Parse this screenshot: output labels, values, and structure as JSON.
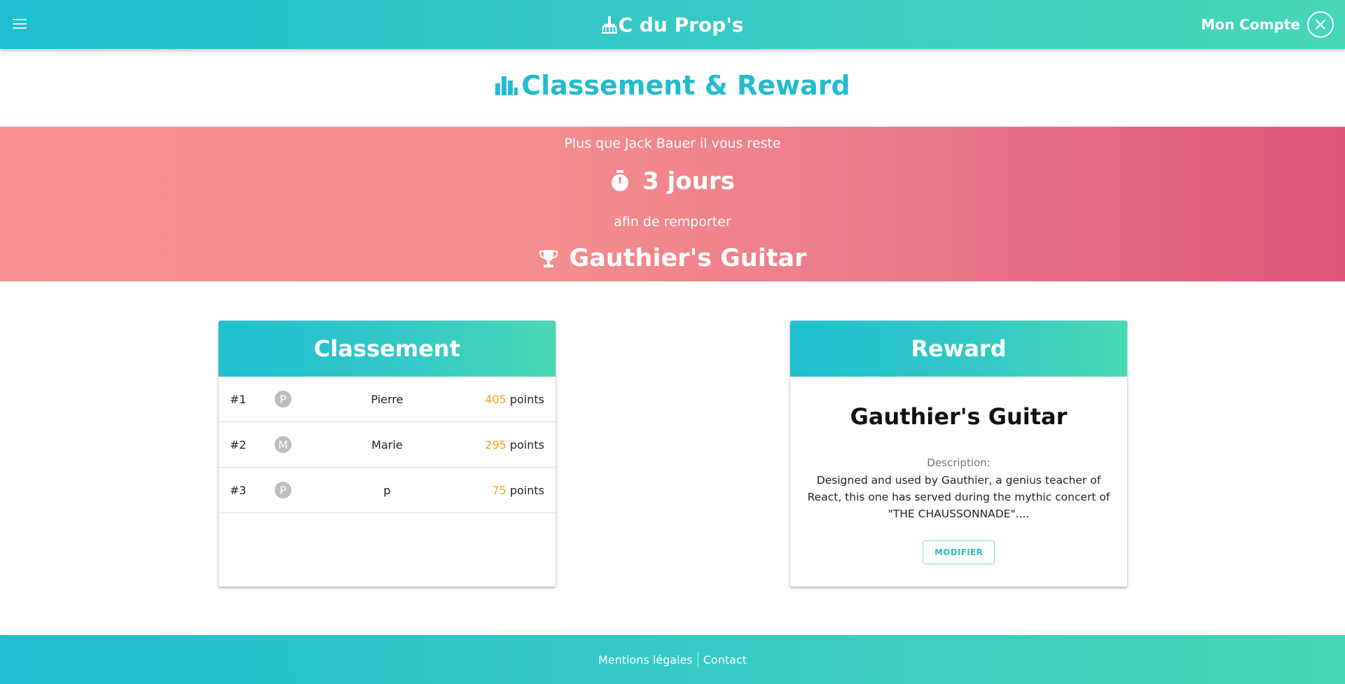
{
  "header": {
    "app_title": "C du Prop's",
    "account_label": "Mon Compte",
    "icons": {
      "menu": "menu-icon",
      "brand": "broom-icon",
      "close": "close-icon"
    }
  },
  "page": {
    "title": "Classement & Reward",
    "title_icon": "bar-chart-icon"
  },
  "banner": {
    "line1": "Plus que Jack Bauer il vous reste",
    "countdown": "3 jours",
    "line2": "afin de remporter",
    "prize": "Gauthier's Guitar",
    "icons": {
      "timer": "stopwatch-icon",
      "prize": "trophy-icon"
    }
  },
  "ranking": {
    "title": "Classement",
    "points_label": "points",
    "rows": [
      {
        "rank": "#1",
        "initial": "P",
        "name": "Pierre",
        "points": "405"
      },
      {
        "rank": "#2",
        "initial": "M",
        "name": "Marie",
        "points": "295"
      },
      {
        "rank": "#3",
        "initial": "P",
        "name": "p",
        "points": "75"
      }
    ]
  },
  "reward": {
    "title": "Reward",
    "name": "Gauthier's Guitar",
    "description_label": "Description:",
    "description": "Designed and used by Gauthier, a genius teacher of React, this one has served during the mythic concert of \"THE CHAUSSONNADE\"....",
    "modify_label": "MODIFIER"
  },
  "footer": {
    "legal_label": "Mentions légales",
    "contact_label": "Contact"
  },
  "colors": {
    "primary": "#21bfd0",
    "primary_end": "#47d6b8",
    "banner_start": "#f78f8f",
    "banner_end": "#de567c",
    "points": "#f5a020"
  }
}
